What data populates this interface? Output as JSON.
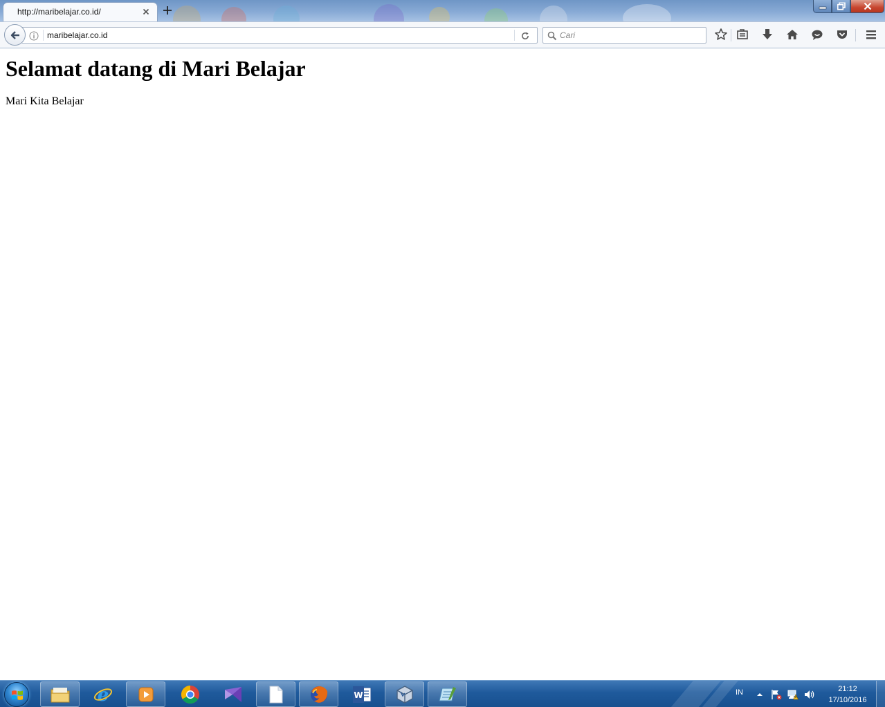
{
  "browser": {
    "tab": {
      "title": "http://maribelajar.co.id/"
    },
    "address_bar": {
      "value": "maribelajar.co.id"
    },
    "search": {
      "placeholder": "Cari"
    },
    "toolbar_icons": [
      "star-icon",
      "reading-list-icon",
      "download-icon",
      "home-icon",
      "chat-icon",
      "pocket-icon",
      "menu-icon"
    ]
  },
  "page": {
    "heading": "Selamat datang di Mari Belajar",
    "paragraph": "Mari Kita Belajar"
  },
  "taskbar": {
    "pinned_apps": [
      "windows-explorer",
      "internet-explorer",
      "media-player",
      "google-chrome",
      "visual-studio",
      "blank-document",
      "firefox",
      "microsoft-word",
      "virtualbox",
      "notepad"
    ],
    "tray": {
      "language": "IN",
      "time": "21:12",
      "date": "17/10/2016"
    }
  },
  "colors": {
    "titlebar": "#88aad5",
    "taskbar": "#1f5a9c",
    "close_button": "#c7462f"
  }
}
